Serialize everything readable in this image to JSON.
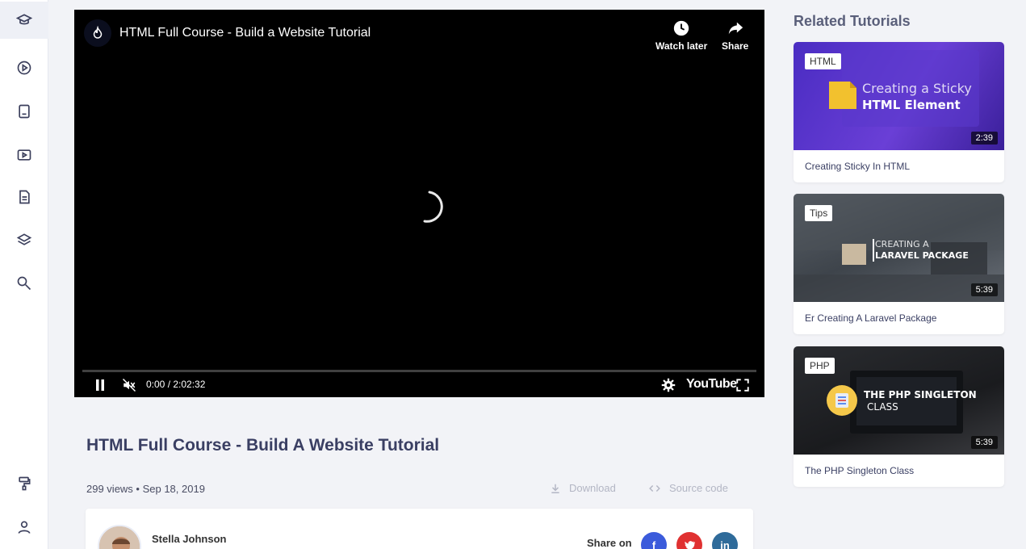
{
  "sidebar": {
    "items": [
      {
        "icon": "graduation-cap-icon"
      },
      {
        "icon": "play-circle-icon"
      },
      {
        "icon": "book-icon"
      },
      {
        "icon": "video-icon"
      },
      {
        "icon": "document-icon"
      },
      {
        "icon": "layers-icon"
      },
      {
        "icon": "search-icon"
      },
      {
        "icon": "paint-roller-icon"
      },
      {
        "icon": "user-icon"
      }
    ]
  },
  "player": {
    "title": "HTML Full Course - Build a Website Tutorial",
    "watch_later": "Watch later",
    "share": "Share",
    "time": "0:00 / 2:02:32",
    "brand": "YouTube"
  },
  "video": {
    "title": "HTML Full Course - Build A Website Tutorial",
    "meta": "299 views • Sep 18, 2019",
    "download_label": "Download",
    "source_code_label": "Source code"
  },
  "author": {
    "name": "Stella Johnson",
    "share_label": "Share on",
    "networks": [
      "facebook",
      "twitter",
      "linkedin"
    ]
  },
  "related": {
    "heading": "Related Tutorials",
    "items": [
      {
        "tag": "HTML",
        "duration": "2:39",
        "caption": "Creating Sticky In HTML",
        "thumb_line1": "Creating a Sticky",
        "thumb_line2": "HTML Element"
      },
      {
        "tag": "Tips",
        "duration": "5:39",
        "caption": "Er Creating A Laravel Package",
        "thumb_line1": "CREATING A",
        "thumb_line2": "LARAVEL PACKAGE"
      },
      {
        "tag": "PHP",
        "duration": "5:39",
        "caption": "The PHP Singleton Class",
        "thumb_line1": "THE PHP SINGLETON",
        "thumb_line2": "CLASS"
      }
    ]
  },
  "colors": {
    "facebook": "#3b5bdb",
    "twitter": "#e03131",
    "linkedin": "#2f6b9a",
    "accent": "#3a3f63"
  }
}
